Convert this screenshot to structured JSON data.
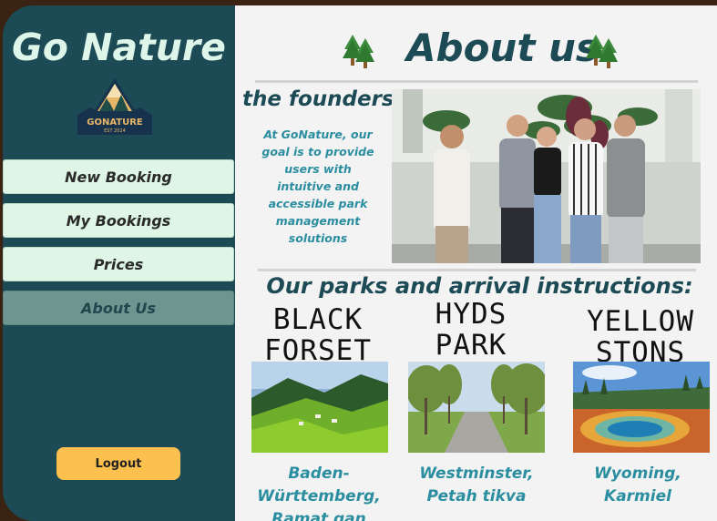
{
  "brand": "Go Nature",
  "logo": {
    "name": "GONATURE",
    "sub": "EST 2024"
  },
  "nav": [
    {
      "label": "New Booking",
      "active": false
    },
    {
      "label": "My Bookings",
      "active": false
    },
    {
      "label": "Prices",
      "active": false
    },
    {
      "label": "About Us",
      "active": true
    }
  ],
  "logout_label": "Logout",
  "page_title": "About us",
  "founders": {
    "heading": "the founders",
    "text": "At GoNature, our goal is to provide users with intuitive and accessible park management solutions"
  },
  "parks_heading": "Our parks and arrival instructions:",
  "parks": [
    {
      "name_line1": "BLACK",
      "name_line2": "FORSET",
      "loc_line1": "Baden-Württemberg,",
      "loc_line2": "Ramat gan"
    },
    {
      "name_line1": "HYDS",
      "name_line2": "PARK",
      "loc_line1": "Westminster,",
      "loc_line2": "Petah tikva"
    },
    {
      "name_line1": "YELLOW",
      "name_line2": "STONS",
      "loc_line1": "Wyoming,",
      "loc_line2": "Karmiel"
    }
  ],
  "colors": {
    "sidebar": "#1c4a55",
    "nav": "#dff6e6",
    "active": "#6d9690",
    "logout": "#fbc04e",
    "accent": "#2b8ea0"
  }
}
